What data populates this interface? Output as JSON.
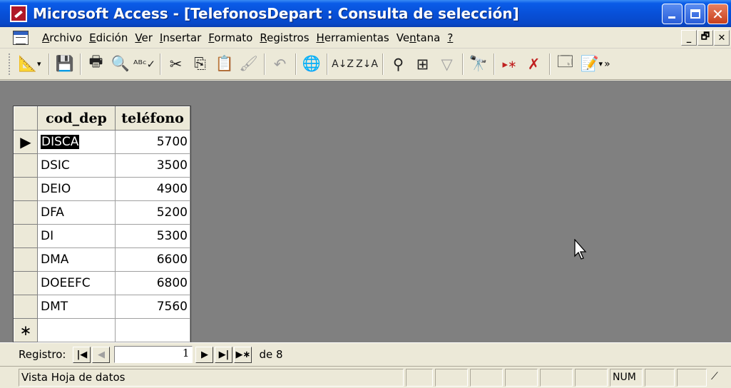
{
  "window": {
    "title": "Microsoft Access - [TelefonosDepart : Consulta de selección]"
  },
  "menu": {
    "items": [
      {
        "label": "Archivo",
        "key": "A",
        "rest": "rchivo"
      },
      {
        "label": "Edición",
        "key": "E",
        "rest": "dición"
      },
      {
        "label": "Ver",
        "key": "V",
        "rest": "er"
      },
      {
        "label": "Insertar",
        "key": "I",
        "rest": "nsertar"
      },
      {
        "label": "Formato",
        "key": "F",
        "rest": "ormato"
      },
      {
        "label": "Registros",
        "key": "R",
        "rest": "egistros"
      },
      {
        "label": "Herramientas",
        "key": "H",
        "rest": "erramientas"
      },
      {
        "label": "Ventana",
        "pre": "Ve",
        "key": "n",
        "rest": "tana"
      },
      {
        "label": "?",
        "key": "?",
        "rest": ""
      }
    ]
  },
  "toolbar": {
    "icons": [
      "design-view-icon",
      "save-icon",
      "print-icon",
      "print-preview-icon",
      "spelling-icon",
      "cut-icon",
      "copy-icon",
      "paste-icon",
      "format-painter-icon",
      "undo-icon",
      "hyperlink-icon",
      "sort-ascending-icon",
      "sort-descending-icon",
      "filter-by-selection-icon",
      "filter-by-form-icon",
      "apply-filter-icon",
      "find-icon",
      "new-record-icon",
      "delete-record-icon",
      "database-window-icon",
      "new-object-icon"
    ]
  },
  "datasheet": {
    "columns": [
      "cod_dep",
      "teléfono"
    ],
    "rows": [
      {
        "cod_dep": "DISCA",
        "telefono": "5700"
      },
      {
        "cod_dep": "DSIC",
        "telefono": "3500"
      },
      {
        "cod_dep": "DEIO",
        "telefono": "4900"
      },
      {
        "cod_dep": "DFA",
        "telefono": "5200"
      },
      {
        "cod_dep": "DI",
        "telefono": "5300"
      },
      {
        "cod_dep": "DMA",
        "telefono": "6600"
      },
      {
        "cod_dep": "DOEEFC",
        "telefono": "6800"
      },
      {
        "cod_dep": "DMT",
        "telefono": "7560"
      }
    ],
    "current_row_marker": "▶",
    "new_row_marker": "∗"
  },
  "recnav": {
    "label": "Registro:",
    "current": "1",
    "of_text": "de 8"
  },
  "status": {
    "text": "Vista Hoja de datos",
    "num": "NUM"
  }
}
